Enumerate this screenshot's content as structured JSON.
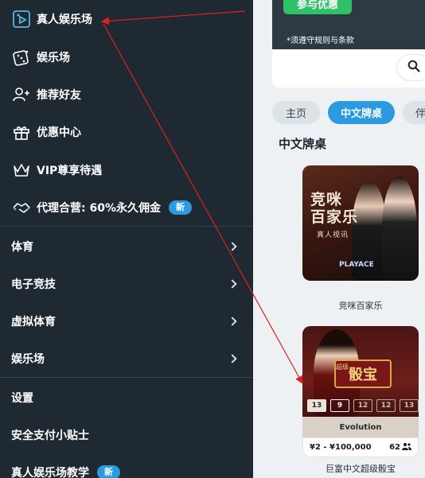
{
  "sidebar": {
    "items": [
      {
        "label": "真人娱乐场",
        "icon": "live-casino-icon"
      },
      {
        "label": "娱乐场",
        "icon": "dice-icon"
      },
      {
        "label": "推荐好友",
        "icon": "add-friend-icon"
      },
      {
        "label": "优惠中心",
        "icon": "gift-icon"
      },
      {
        "label": "VIP尊享待遇",
        "icon": "crown-icon"
      },
      {
        "label": "代理合营: 60%永久佣金",
        "icon": "handshake-icon",
        "badge": "新"
      }
    ],
    "categories": [
      {
        "label": "体育"
      },
      {
        "label": "电子竞技"
      },
      {
        "label": "虚拟体育"
      },
      {
        "label": "娱乐场"
      }
    ],
    "footer_items": [
      {
        "label": "设置"
      },
      {
        "label": "安全支付小贴士"
      },
      {
        "label": "真人娱乐场教学",
        "badge": "新"
      }
    ]
  },
  "main": {
    "promo": {
      "button_label": "参与优惠",
      "terms": "*须遵守规则与条款"
    },
    "tabs": [
      {
        "label": "主页",
        "active": false
      },
      {
        "label": "中文牌桌",
        "active": true
      },
      {
        "label": "伴",
        "active": false
      }
    ],
    "section_title": "中文牌桌",
    "games": [
      {
        "name": "竞咪百家乐",
        "art_title_line1": "竞咪",
        "art_title_line2": "百家乐",
        "art_subtitle": "真人视讯",
        "art_logo": "PLAYACE"
      },
      {
        "name": "巨富中文超级骰宝",
        "art_super": "超级",
        "art_sign": "骰宝",
        "results": [
          "13",
          "9",
          "12",
          "12",
          "13"
        ],
        "provider": "Evolution",
        "limits": "¥2 - ¥100,000",
        "players": "62"
      }
    ]
  },
  "colors": {
    "sidebar_bg": "#1f2931",
    "accent": "#2b9ae0",
    "promo_green": "#2fc068",
    "annotation_red": "#e02020"
  }
}
